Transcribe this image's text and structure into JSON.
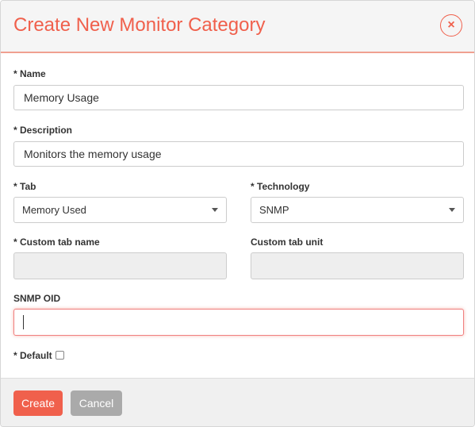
{
  "dialog": {
    "title": "Create New Monitor Category",
    "close_symbol": "×",
    "close_icon": "close-circle-icon"
  },
  "form": {
    "name": {
      "label": "* Name",
      "value": "Memory Usage"
    },
    "description": {
      "label": "* Description",
      "value": "Monitors the memory usage"
    },
    "tab": {
      "label": "* Tab",
      "selected": "Memory Used"
    },
    "technology": {
      "label": "* Technology",
      "selected": "SNMP"
    },
    "custom_tab_name": {
      "label": "* Custom tab name",
      "value": ""
    },
    "custom_tab_unit": {
      "label": "Custom tab unit",
      "value": ""
    },
    "snmp_oid": {
      "label": "SNMP OID",
      "value": ""
    },
    "default": {
      "label": "* Default",
      "checked": false
    }
  },
  "footer": {
    "create_label": "Create",
    "cancel_label": "Cancel"
  },
  "colors": {
    "accent": "#f0604c",
    "cancel": "#aaaaaa"
  }
}
